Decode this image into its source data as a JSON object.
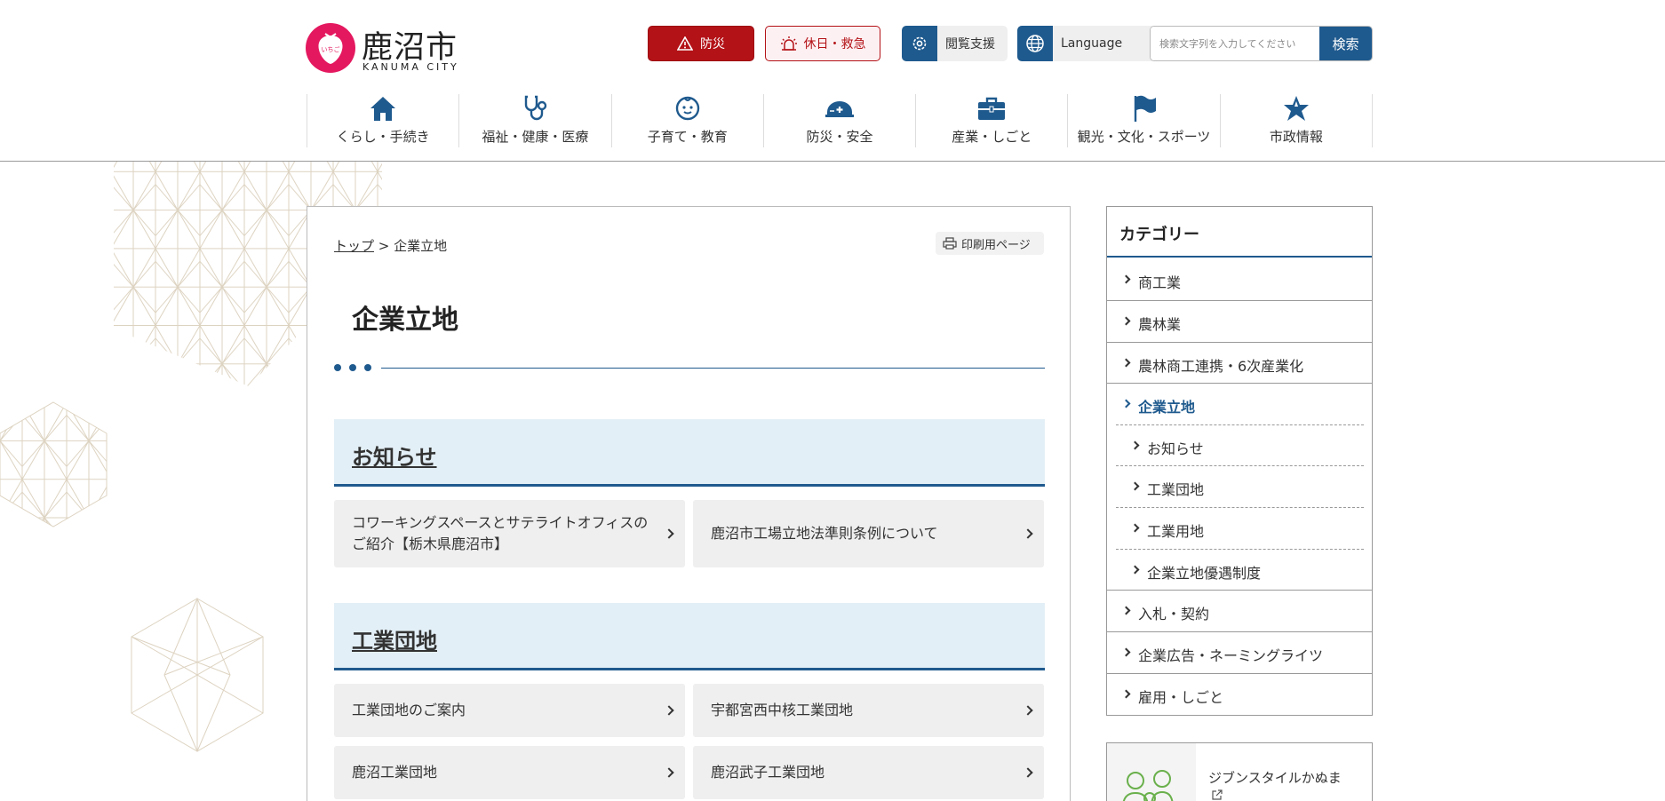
{
  "header": {
    "logo": {
      "name": "鹿沼市",
      "name_en": "KANUMA CITY",
      "mark_text": "いちご"
    },
    "buttons": {
      "bousai": "防災",
      "kyukyu": "休日・救急",
      "etsuran": "閲覧支援",
      "language": "Language"
    },
    "search": {
      "placeholder": "検索文字列を入力してください",
      "button": "検索"
    }
  },
  "nav": [
    {
      "label": "くらし・手続き",
      "icon": "home-icon"
    },
    {
      "label": "福祉・健康・医療",
      "icon": "stethoscope-icon"
    },
    {
      "label": "子育て・教育",
      "icon": "baby-icon"
    },
    {
      "label": "防災・安全",
      "icon": "helmet-icon"
    },
    {
      "label": "産業・しごと",
      "icon": "briefcase-icon"
    },
    {
      "label": "観光・文化・スポーツ",
      "icon": "flag-icon"
    },
    {
      "label": "市政情報",
      "icon": "emblem-icon"
    }
  ],
  "breadcrumb": {
    "top": "トップ",
    "separator": ">",
    "current": "企業立地"
  },
  "print_label": "印刷用ページ",
  "page_title": "企業立地",
  "sections": [
    {
      "title": "お知らせ",
      "links": [
        "コワーキングスペースとサテライトオフィスのご紹介【栃木県鹿沼市】",
        "鹿沼市工場立地法準則条例について"
      ]
    },
    {
      "title": "工業団地",
      "links": [
        "工業団地のご案内",
        "宇都宮西中核工業団地",
        "鹿沼工業団地",
        "鹿沼武子工業団地"
      ]
    }
  ],
  "sidebar": {
    "heading": "カテゴリー",
    "items": [
      {
        "label": "商工業"
      },
      {
        "label": "農林業"
      },
      {
        "label": "農林商工連携・6次産業化"
      },
      {
        "label": "企業立地",
        "active": true
      },
      {
        "label": "お知らせ",
        "sub": true
      },
      {
        "label": "工業団地",
        "sub": true
      },
      {
        "label": "工業用地",
        "sub": true
      },
      {
        "label": "企業立地優遇制度",
        "sub": true
      },
      {
        "label": "入札・契約"
      },
      {
        "label": "企業広告・ネーミングライツ"
      },
      {
        "label": "雇用・しごと"
      }
    ],
    "banner": {
      "label": "ジブンスタイルかぬま",
      "external_icon": "external-link-icon"
    }
  },
  "colors": {
    "primary": "#1f5a8e",
    "danger": "#b31217",
    "logo": "#e4185f",
    "section_bg": "#e3eff6"
  }
}
